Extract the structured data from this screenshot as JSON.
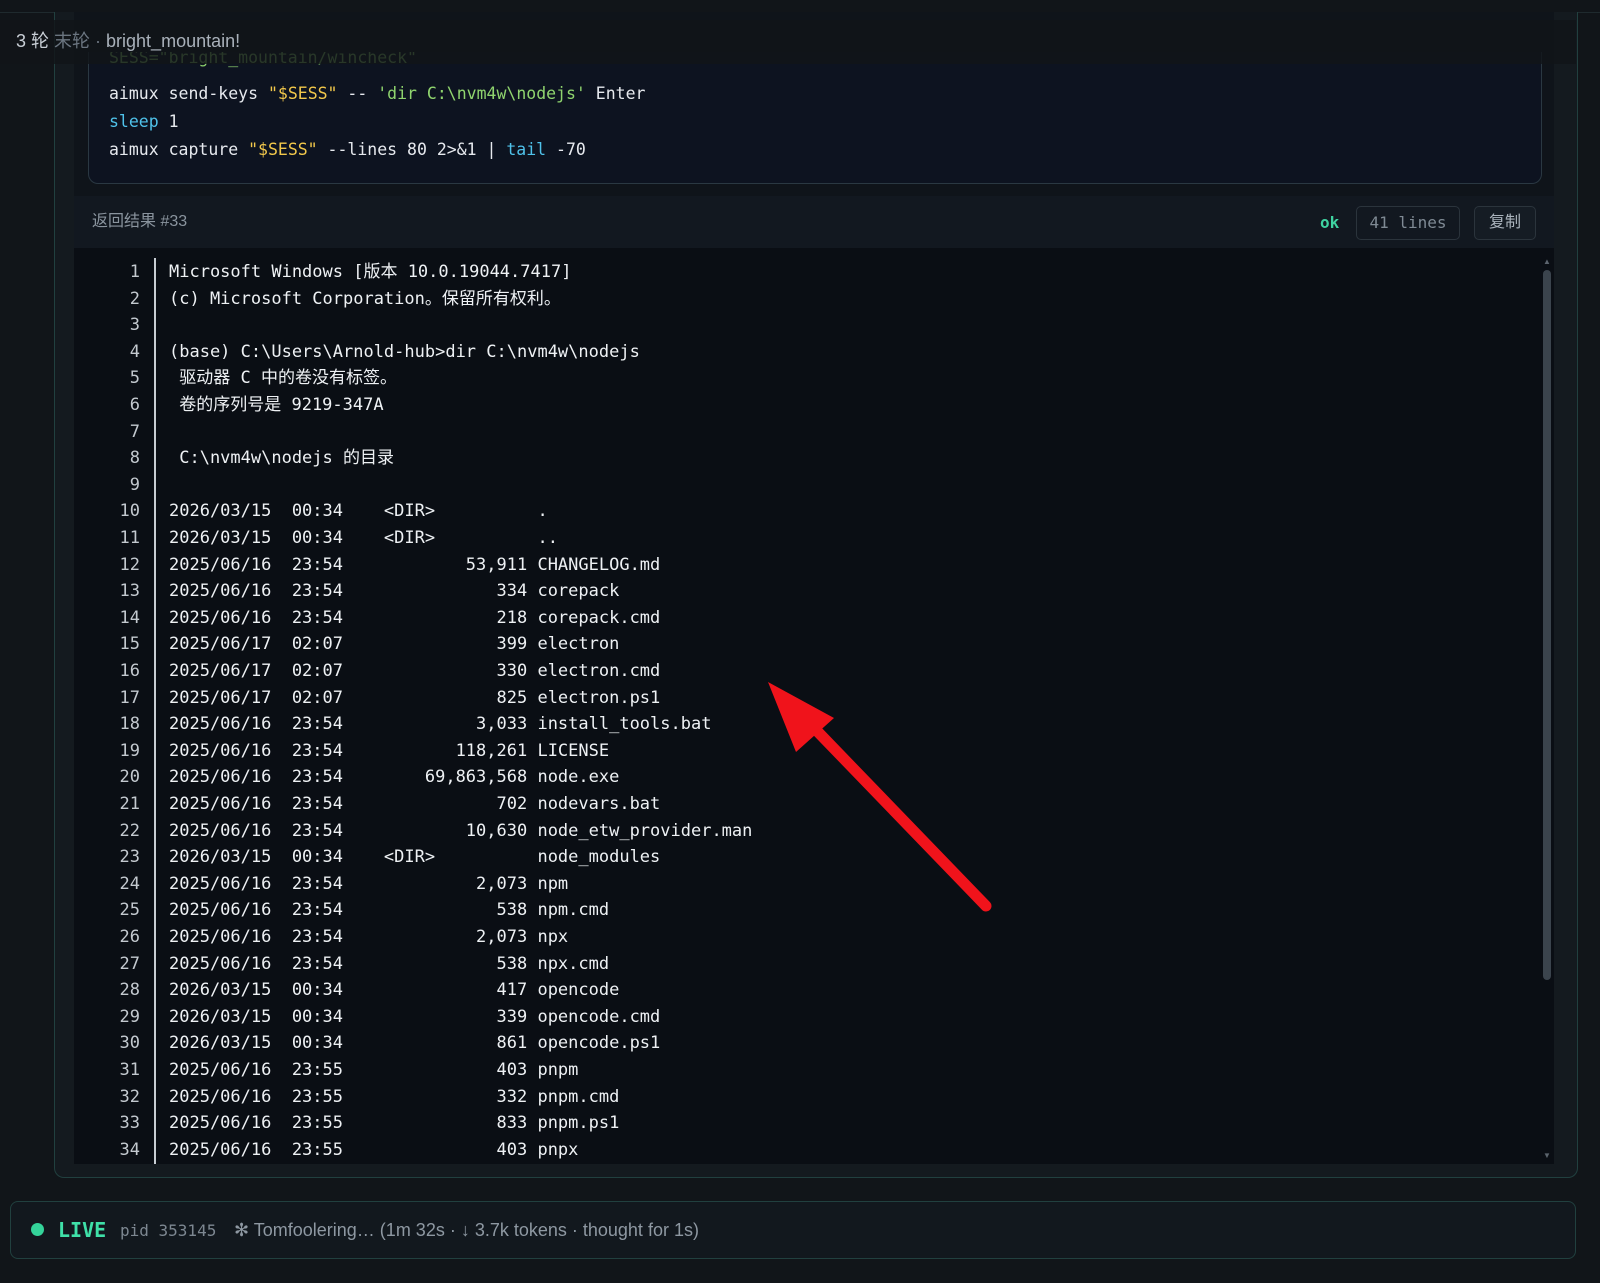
{
  "breadcrumb": {
    "turns": "3 轮",
    "last_turn": "末轮",
    "separator": " · ",
    "session": "bright_mountain!"
  },
  "command": {
    "line0": "SESS=\"bright_mountain/wincheck\"",
    "line1_cmd": "aimux send-keys ",
    "line1_var": "\"$SESS\"",
    "line1_mid": " -- ",
    "line1_str": "'dir C:\\nvm4w\\nodejs'",
    "line1_end": " Enter",
    "line2_kw": "sleep",
    "line2_arg": " 1",
    "line3_cmd": "aimux capture ",
    "line3_var": "\"$SESS\"",
    "line3_mid": " --lines 80 2>&1 | ",
    "line3_kw": "tail",
    "line3_end": " -70"
  },
  "result": {
    "label": "返回结果 #33",
    "status": "ok",
    "line_count": "41 lines",
    "copy_label": "复制"
  },
  "terminal_lines": [
    "Microsoft Windows [版本 10.0.19044.7417]",
    "(c) Microsoft Corporation。保留所有权利。",
    "",
    "(base) C:\\Users\\Arnold-hub>dir C:\\nvm4w\\nodejs",
    " 驱动器 C 中的卷没有标签。",
    " 卷的序列号是 9219-347A",
    "",
    " C:\\nvm4w\\nodejs 的目录",
    "",
    "2026/03/15  00:34    <DIR>          .",
    "2026/03/15  00:34    <DIR>          ..",
    "2025/06/16  23:54            53,911 CHANGELOG.md",
    "2025/06/16  23:54               334 corepack",
    "2025/06/16  23:54               218 corepack.cmd",
    "2025/06/17  02:07               399 electron",
    "2025/06/17  02:07               330 electron.cmd",
    "2025/06/17  02:07               825 electron.ps1",
    "2025/06/16  23:54             3,033 install_tools.bat",
    "2025/06/16  23:54           118,261 LICENSE",
    "2025/06/16  23:54        69,863,568 node.exe",
    "2025/06/16  23:54               702 nodevars.bat",
    "2025/06/16  23:54            10,630 node_etw_provider.man",
    "2026/03/15  00:34    <DIR>          node_modules",
    "2025/06/16  23:54             2,073 npm",
    "2025/06/16  23:54               538 npm.cmd",
    "2025/06/16  23:54             2,073 npx",
    "2025/06/16  23:54               538 npx.cmd",
    "2026/03/15  00:34               417 opencode",
    "2026/03/15  00:34               339 opencode.cmd",
    "2026/03/15  00:34               861 opencode.ps1",
    "2025/06/16  23:55               403 pnpm",
    "2025/06/16  23:55               332 pnpm.cmd",
    "2025/06/16  23:55               833 pnpm.ps1",
    "2025/06/16  23:55               403 pnpx"
  ],
  "live": {
    "label": "LIVE",
    "pid": "pid 353145",
    "status": "✻ Tomfoolering… (1m 32s · ↓ 3.7k tokens · thought for 1s)"
  },
  "colors": {
    "accent": "#3fe0a8",
    "annotation_arrow": "#f0131b",
    "string": "#f2c84b",
    "keyword": "#4fc2ea"
  },
  "icons": {
    "live": "live-dot-icon",
    "annotation": "red-arrow-icon"
  }
}
